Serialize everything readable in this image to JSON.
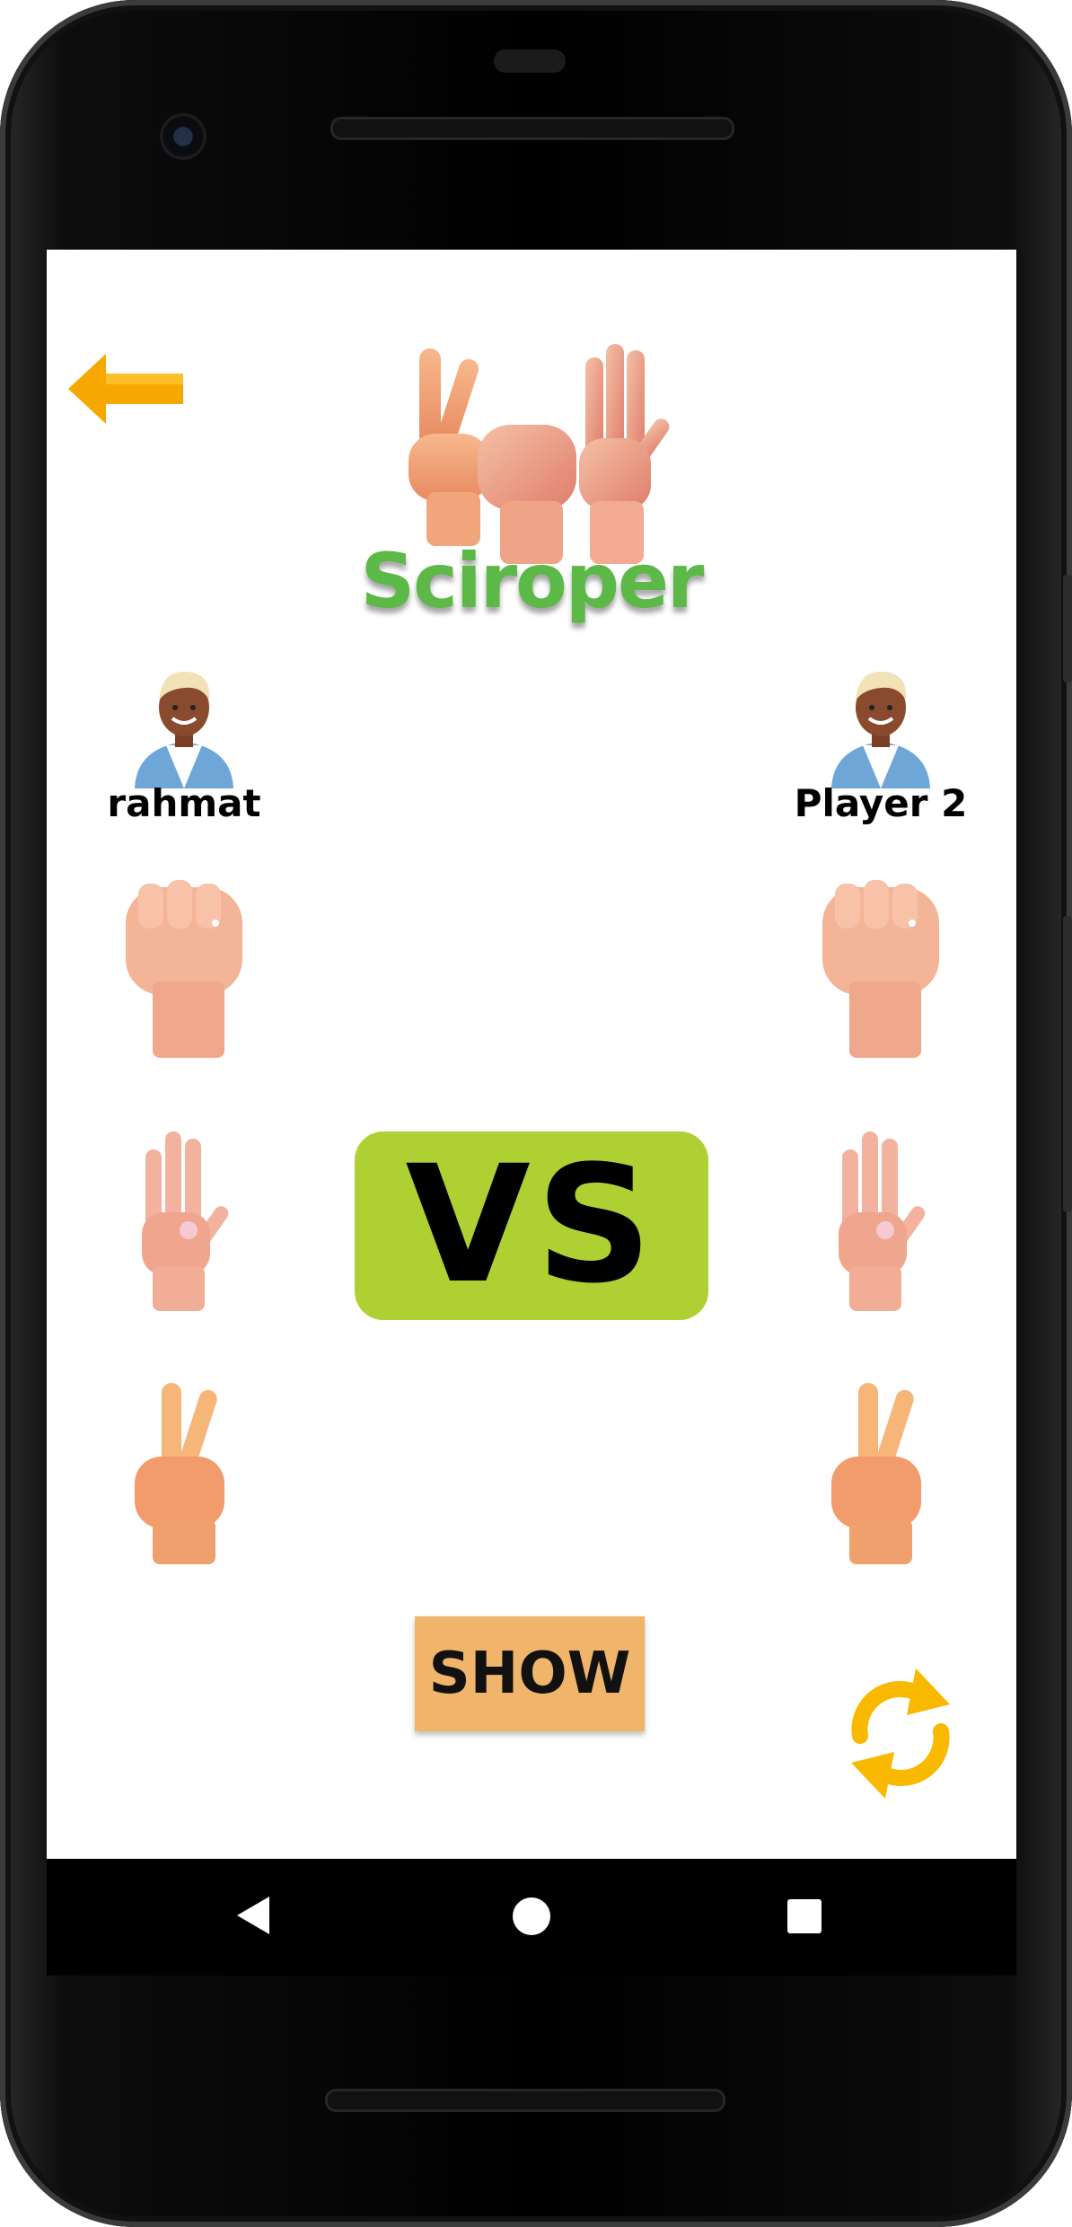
{
  "app": {
    "title": "Sciroper"
  },
  "players": [
    {
      "name": "rahmat"
    },
    {
      "name": "Player 2"
    }
  ],
  "choices": [
    "rock",
    "paper",
    "scissors"
  ],
  "center": {
    "vs_label": "VS"
  },
  "actions": {
    "show_label": "SHOW"
  },
  "colors": {
    "title_green": "#5cb847",
    "vs_background": "#afd033",
    "show_background": "#f0b46a",
    "accent_orange": "#f6a800",
    "refresh_yellow": "#f9b900"
  },
  "navigation": {
    "icons": [
      "nav-back-icon",
      "nav-home-icon",
      "nav-recents-icon"
    ]
  }
}
